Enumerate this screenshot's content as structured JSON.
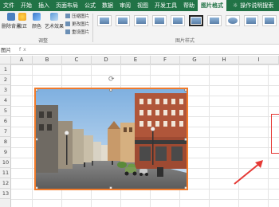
{
  "ribbon_tabs": [
    "文件",
    "开始",
    "插入",
    "页面布局",
    "公式",
    "数据",
    "审阅",
    "视图",
    "开发工具",
    "帮助",
    "图片格式"
  ],
  "active_tab": "图片格式",
  "search_label": "操作说明搜索",
  "ribbon": {
    "remove_bg_label": "删除背景",
    "correct_label": "校正",
    "color_label": "颜色",
    "artistic_label": "艺术效果",
    "compress_label": "压缩图片",
    "change_label": "更改图片",
    "reset_label": "重设图片",
    "adjust_group_label": "调整",
    "styles_group_label": "图片样式"
  },
  "name_box": "图片 2",
  "formula_fx": "fx",
  "columns": [
    "A",
    "B",
    "C",
    "D",
    "E",
    "F",
    "G",
    "H",
    "I"
  ],
  "rows": [
    "1",
    "2",
    "3",
    "4",
    "5",
    "6",
    "7",
    "8",
    "9",
    "10",
    "11",
    "12",
    "13"
  ],
  "colors": {
    "ribbon_green": "#217346",
    "selection_orange": "#f07a2a",
    "annotation_red": "#e53935"
  }
}
